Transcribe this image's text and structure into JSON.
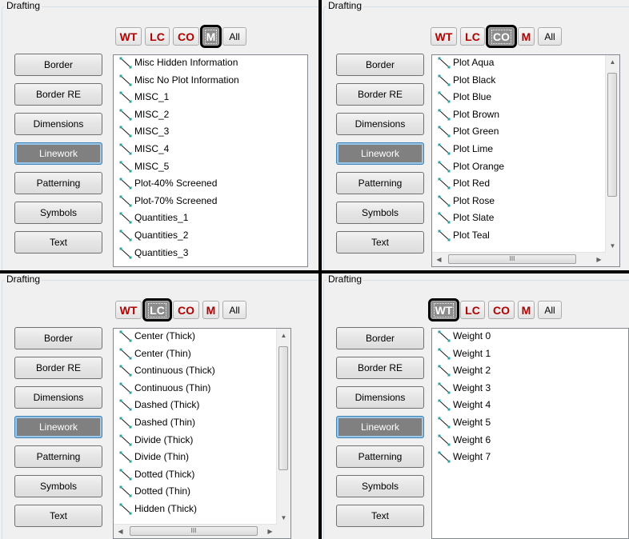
{
  "filter_labels": [
    "WT",
    "LC",
    "CO",
    "M",
    "All"
  ],
  "categories": [
    "Border",
    "Border RE",
    "Dimensions",
    "Linework",
    "Patterning",
    "Symbols",
    "Text"
  ],
  "panels": [
    {
      "group_title": "Drafting",
      "active_filter": "M",
      "selected_category": "Linework",
      "items": [
        "Misc Hidden Information",
        "Misc No Plot Information",
        "MISC_1",
        "MISC_2",
        "MISC_3",
        "MISC_4",
        "MISC_5",
        "Plot-40% Screened",
        "Plot-70% Screened",
        "Quantities_1",
        "Quantities_2",
        "Quantities_3"
      ],
      "vscroll": false,
      "hscroll": false
    },
    {
      "group_title": "Drafting",
      "active_filter": "CO",
      "selected_category": "Linework",
      "items": [
        "Plot Aqua",
        "Plot Black",
        "Plot Blue",
        "Plot Brown",
        "Plot Green",
        "Plot Lime",
        "Plot Orange",
        "Plot Red",
        "Plot Rose",
        "Plot Slate",
        "Plot Teal"
      ],
      "vscroll": true,
      "hscroll": true
    },
    {
      "group_title": "Drafting",
      "active_filter": "LC",
      "selected_category": "Linework",
      "items": [
        "Center (Thick)",
        "Center (Thin)",
        "Continuous (Thick)",
        "Continuous (Thin)",
        "Dashed (Thick)",
        "Dashed (Thin)",
        "Divide (Thick)",
        "Divide (Thin)",
        "Dotted (Thick)",
        "Dotted (Thin)",
        "Hidden (Thick)"
      ],
      "vscroll": true,
      "hscroll": true
    },
    {
      "group_title": "Drafting",
      "active_filter": "WT",
      "selected_category": "Linework",
      "items": [
        "Weight 0",
        "Weight 1",
        "Weight 2",
        "Weight 3",
        "Weight 4",
        "Weight 5",
        "Weight 6",
        "Weight 7"
      ],
      "vscroll": false,
      "hscroll": false
    }
  ],
  "icons": {
    "item": "diagonal-line-icon"
  },
  "colors": {
    "filter_text": "#b00000",
    "active_filter_bg": "#8c8c8c",
    "selected_category_bg": "#808080"
  }
}
